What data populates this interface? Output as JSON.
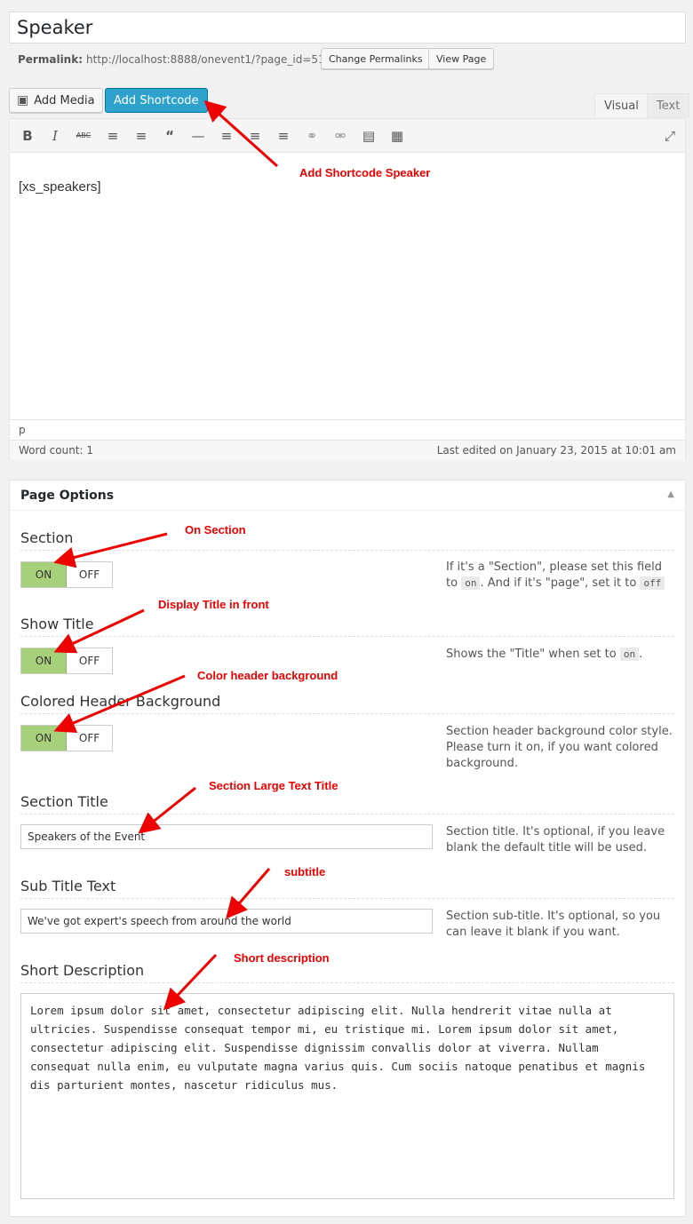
{
  "post": {
    "title": "Speaker",
    "permalink_label": "Permalink:",
    "permalink_url": "http://localhost:8888/onevent1/?page_id=51",
    "change_permalinks": "Change Permalinks",
    "view_page": "View Page"
  },
  "media": {
    "add_media": "Add Media",
    "add_shortcode": "Add Shortcode"
  },
  "editor_tabs": {
    "visual": "Visual",
    "text": "Text"
  },
  "toolbar": {
    "icons": [
      "bold-icon",
      "italic-icon",
      "strikethrough-icon",
      "bullet-list-icon",
      "numbered-list-icon",
      "blockquote-icon",
      "horizontal-rule-icon",
      "align-left-icon",
      "align-center-icon",
      "align-right-icon",
      "link-icon",
      "unlink-icon",
      "read-more-icon",
      "toolbar-toggle-icon",
      "fullscreen-icon"
    ],
    "bold": "B",
    "italic": "I",
    "strike": "ABC"
  },
  "editor": {
    "content": "[xs_speakers]",
    "path": "p",
    "word_count": "Word count: 1",
    "last_edited": "Last edited on January 23, 2015 at 10:01 am"
  },
  "page_options": {
    "title": "Page Options",
    "section": {
      "label": "Section",
      "on": "ON",
      "off": "OFF",
      "help_1": "If it's a \"Section\", please set this field to",
      "code_on": "on",
      "help_2": ". And if it's \"page\", set it to",
      "code_off": "off"
    },
    "show_title": {
      "label": "Show Title",
      "on": "ON",
      "off": "OFF",
      "help_1": "Shows the \"Title\" when set to",
      "code_on": "on",
      "help_2": "."
    },
    "colored_header": {
      "label": "Colored Header Background",
      "on": "ON",
      "off": "OFF",
      "help": "Section header background color style. Please turn it on, if you want colored background."
    },
    "section_title": {
      "label": "Section Title",
      "value": "Speakers of the Event",
      "help": "Section title. It's optional, if you leave blank the default title will be used."
    },
    "sub_title": {
      "label": "Sub Title Text",
      "value": "We've got expert's speech from around the world",
      "help": "Section sub-title. It's optional, so you can leave it blank if you want."
    },
    "short_description": {
      "label": "Short Description",
      "value": "Lorem ipsum dolor sit amet, consectetur adipiscing elit. Nulla hendrerit vitae nulla at ultricies. Suspendisse consequat tempor mi, eu tristique mi. Lorem ipsum dolor sit amet, consectetur adipiscing elit. Suspendisse dignissim convallis dolor at viverra. Nullam consequat nulla enim, eu vulputate magna varius quis. Cum sociis natoque penatibus et magnis dis parturient montes, nascetur ridiculus mus."
    }
  },
  "annotations": {
    "add_shortcode": "Add Shortcode Speaker",
    "on_section": "On Section",
    "display_title": "Display Title in front",
    "color_header": "Color header background",
    "section_large": "Section Large Text Title",
    "subtitle": "subtitle",
    "short_desc": "Short description"
  },
  "colors": {
    "annotation": "#ee0000",
    "toggle_on": "#a6d07a",
    "primary_button": "#2ea2cc"
  }
}
